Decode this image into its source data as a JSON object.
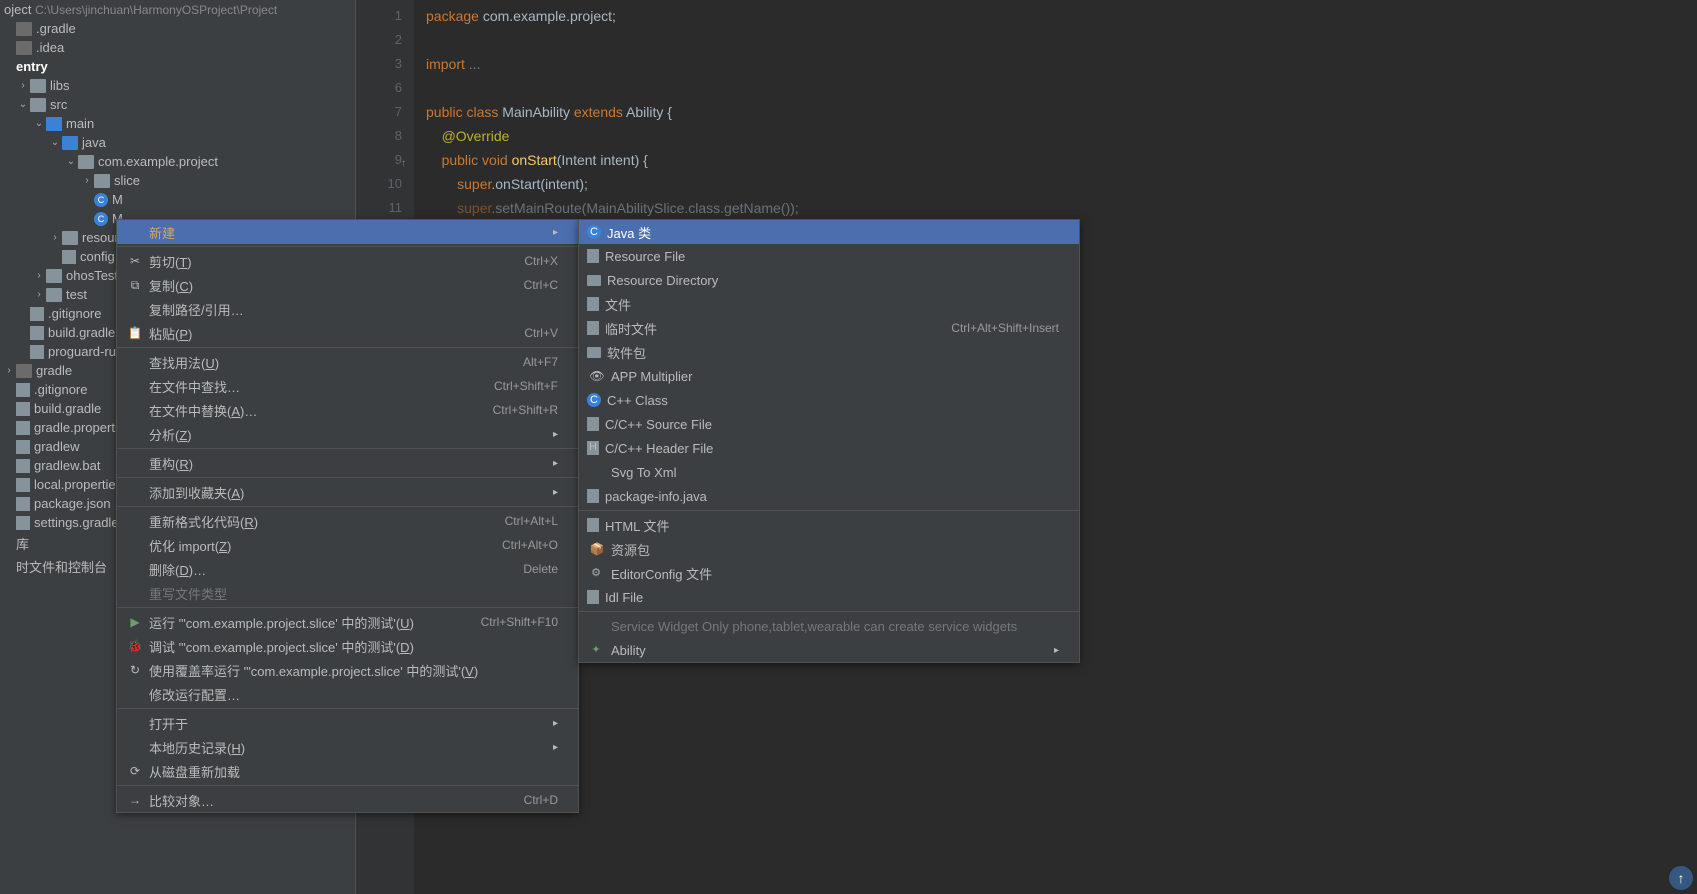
{
  "project": {
    "header": "oject",
    "path": "C:\\Users\\jinchuan\\HarmonyOSProject\\Project",
    "tree": [
      {
        "label": ".gradle",
        "indent": "i0",
        "icon": "folder-dark"
      },
      {
        "label": ".idea",
        "indent": "i0",
        "icon": "folder-dark"
      },
      {
        "label": "entry",
        "indent": "i0",
        "bold": true
      },
      {
        "label": "libs",
        "indent": "i1",
        "icon": "folder",
        "chev": "›"
      },
      {
        "label": "src",
        "indent": "i1",
        "icon": "folder",
        "chev": "⌄"
      },
      {
        "label": "main",
        "indent": "i2",
        "icon": "folder-blue",
        "chev": "⌄"
      },
      {
        "label": "java",
        "indent": "i3",
        "icon": "folder-blue",
        "chev": "⌄"
      },
      {
        "label": "com.example.project",
        "indent": "i4",
        "icon": "folder",
        "chev": "⌄"
      },
      {
        "label": "slice",
        "indent": "i5",
        "icon": "folder",
        "chev": "›",
        "truncated": true
      },
      {
        "label": "M",
        "indent": "i5",
        "icon": "class"
      },
      {
        "label": "M",
        "indent": "i5",
        "icon": "class"
      },
      {
        "label": "resource",
        "indent": "i3",
        "icon": "folder",
        "chev": "›"
      },
      {
        "label": "config.js",
        "indent": "i3",
        "icon": "file"
      },
      {
        "label": "ohosTest",
        "indent": "i2",
        "icon": "folder",
        "chev": "›"
      },
      {
        "label": "test",
        "indent": "i2",
        "icon": "folder",
        "chev": "›"
      },
      {
        "label": ".gitignore",
        "indent": "i1",
        "icon": "file"
      },
      {
        "label": "build.gradle",
        "indent": "i1",
        "icon": "file"
      },
      {
        "label": "proguard-rules",
        "indent": "i1",
        "icon": "file"
      },
      {
        "label": "gradle",
        "indent": "i0",
        "icon": "folder-dark",
        "chev": "›"
      },
      {
        "label": ".gitignore",
        "indent": "i0",
        "icon": "file"
      },
      {
        "label": "build.gradle",
        "indent": "i0",
        "icon": "file"
      },
      {
        "label": "gradle.properties",
        "indent": "i0",
        "icon": "file"
      },
      {
        "label": "gradlew",
        "indent": "i0",
        "icon": "file"
      },
      {
        "label": "gradlew.bat",
        "indent": "i0",
        "icon": "file"
      },
      {
        "label": "local.properties",
        "indent": "i0",
        "icon": "file"
      },
      {
        "label": "package.json",
        "indent": "i0",
        "icon": "file"
      },
      {
        "label": "settings.gradle",
        "indent": "i0",
        "icon": "file"
      },
      {
        "label": "库",
        "indent": "i0"
      },
      {
        "label": "时文件和控制台",
        "indent": "i0"
      }
    ]
  },
  "gutter": [
    "1",
    "2",
    "3",
    "6",
    "7",
    "8",
    "9",
    "10",
    "11"
  ],
  "code": {
    "l1_package": "package ",
    "l1_pkg": "com.example.project",
    "l1_semi": ";",
    "l3_import": "import ",
    "l3_ell": "...",
    "l5_public": "public class ",
    "l5_cls": "MainAbility ",
    "l5_ext": "extends ",
    "l5_sup": "Ability ",
    "l5_brace": "{",
    "l6_indent": "    ",
    "l6_ann": "@Override",
    "l7_indent": "    ",
    "l7_pub": "public void ",
    "l7_method": "onStart",
    "l7_sig": "(Intent intent) {",
    "l8_indent": "        ",
    "l8_super": "super",
    "l8_dot": ".",
    "l8_call": "onStart",
    "l8_args": "(intent);",
    "l9_indent": "        ",
    "l9_super": "super",
    "l9_dot": ".",
    "l9_call": "setMainRoute",
    "l9_args": "(MainAbilitySlice.class.getName());"
  },
  "menu1": [
    {
      "label": "新建",
      "highlighted": true,
      "selected": true,
      "sub": true
    },
    {
      "sep": true
    },
    {
      "icon": "✂",
      "label": "剪切(T)",
      "shortcut": "Ctrl+X",
      "u": "T"
    },
    {
      "icon": "⧉",
      "label": "复制(C)",
      "shortcut": "Ctrl+C",
      "u": "C"
    },
    {
      "label": "复制路径/引用…"
    },
    {
      "icon": "📋",
      "label": "粘贴(P)",
      "shortcut": "Ctrl+V",
      "u": "P"
    },
    {
      "sep": true
    },
    {
      "label": "查找用法(U)",
      "shortcut": "Alt+F7",
      "u": "U"
    },
    {
      "label": "在文件中查找…",
      "shortcut": "Ctrl+Shift+F"
    },
    {
      "label": "在文件中替换(A)…",
      "shortcut": "Ctrl+Shift+R",
      "u": "A"
    },
    {
      "label": "分析(Z)",
      "sub": true,
      "u": "Z"
    },
    {
      "sep": true
    },
    {
      "label": "重构(R)",
      "sub": true,
      "u": "R"
    },
    {
      "sep": true
    },
    {
      "label": "添加到收藏夹(A)",
      "sub": true,
      "u": "A"
    },
    {
      "sep": true
    },
    {
      "label": "重新格式化代码(R)",
      "shortcut": "Ctrl+Alt+L",
      "u": "R"
    },
    {
      "label": "优化 import(Z)",
      "shortcut": "Ctrl+Alt+O",
      "u": "Z"
    },
    {
      "label": "删除(D)…",
      "shortcut": "Delete",
      "u": "D"
    },
    {
      "label": "重写文件类型",
      "disabled": true
    },
    {
      "sep": true
    },
    {
      "icon": "▶",
      "label": "运行 '\"com.example.project.slice' 中的测试'(U)",
      "shortcut": "Ctrl+Shift+F10",
      "u": "U",
      "iconColor": "#689f6a"
    },
    {
      "icon": "🐞",
      "label": "调试 '\"com.example.project.slice' 中的测试'(D)",
      "u": "D"
    },
    {
      "icon": "↻",
      "label": "使用覆盖率运行 '\"com.example.project.slice' 中的测试'(V)",
      "u": "V"
    },
    {
      "label": "修改运行配置…"
    },
    {
      "sep": true
    },
    {
      "label": "打开于",
      "sub": true
    },
    {
      "label": "本地历史记录(H)",
      "sub": true,
      "u": "H"
    },
    {
      "icon": "⟳",
      "label": "从磁盘重新加载"
    },
    {
      "sep": true
    },
    {
      "icon": "→",
      "label": "比较对象…",
      "shortcut": "Ctrl+D"
    }
  ],
  "menu2": [
    {
      "icon": "C",
      "iconCls": "ic-class",
      "label": "Java 类",
      "selected": true
    },
    {
      "icon": "",
      "iconCls": "ic-file",
      "label": "Resource File"
    },
    {
      "icon": "",
      "iconCls": "ic-folder",
      "label": "Resource Directory"
    },
    {
      "icon": "",
      "iconCls": "ic-file",
      "label": "文件"
    },
    {
      "icon": "",
      "iconCls": "ic-file",
      "label": "临时文件",
      "shortcut": "Ctrl+Alt+Shift+Insert"
    },
    {
      "icon": "",
      "iconCls": "ic-folder",
      "label": "软件包"
    },
    {
      "icon": "👁",
      "label": "APP Multiplier"
    },
    {
      "icon": "C",
      "iconCls": "ic-class",
      "label": "C++ Class"
    },
    {
      "icon": "",
      "iconCls": "ic-file",
      "label": "C/C++ Source File"
    },
    {
      "icon": "H",
      "iconCls": "ic-file",
      "label": "C/C++ Header File"
    },
    {
      "icon": "",
      "label": "Svg To Xml"
    },
    {
      "icon": "",
      "iconCls": "ic-file",
      "label": "package-info.java"
    },
    {
      "sep": true
    },
    {
      "icon": "",
      "iconCls": "ic-file",
      "label": "HTML 文件"
    },
    {
      "icon": "📦",
      "label": "资源包"
    },
    {
      "icon": "⚙",
      "iconCls": "ic-gear",
      "label": "EditorConfig 文件"
    },
    {
      "icon": "",
      "iconCls": "ic-file",
      "label": "Idl File"
    },
    {
      "sep": true
    },
    {
      "icon": "",
      "label": "Service Widget Only phone,tablet,wearable can create service widgets",
      "disabled": true
    },
    {
      "icon": "✦",
      "iconCls": "ic-star",
      "label": "Ability",
      "sub": true
    }
  ]
}
